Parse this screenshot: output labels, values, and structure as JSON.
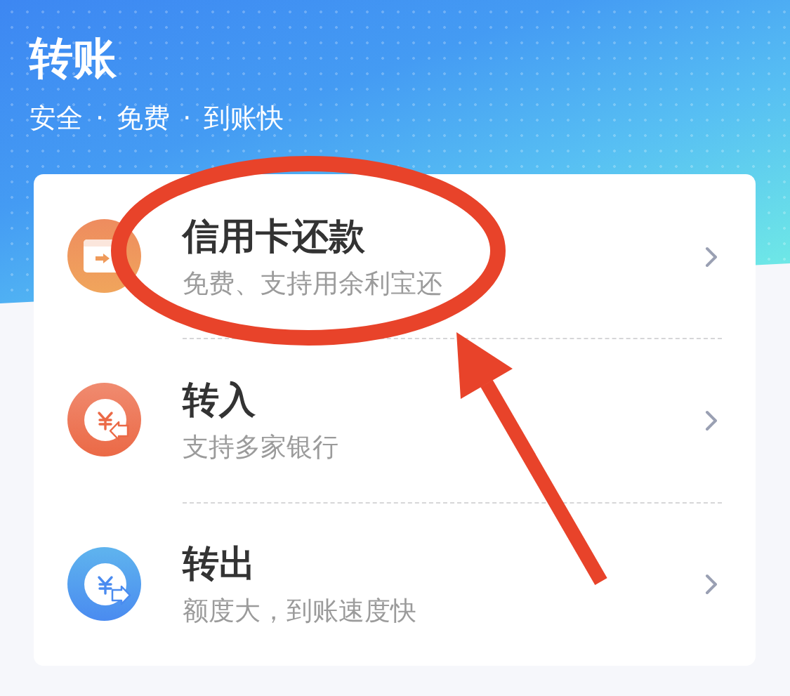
{
  "header": {
    "title": "转账",
    "subtitle": "安全 · 免费 · 到账快"
  },
  "options": [
    {
      "kind": "credit-card",
      "title": "信用卡还款",
      "subtitle": "免费、支持用余利宝还"
    },
    {
      "kind": "transfer-in",
      "title": "转入",
      "subtitle": "支持多家银行"
    },
    {
      "kind": "transfer-out",
      "title": "转出",
      "subtitle": "额度大，到账速度快"
    }
  ]
}
